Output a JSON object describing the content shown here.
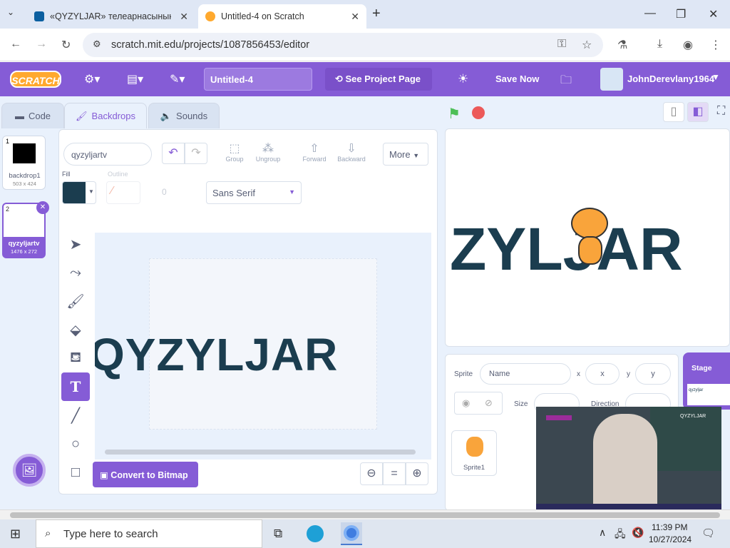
{
  "browser": {
    "tabs": [
      {
        "title": "«QYZYLJAR» телеарнасының р"
      },
      {
        "title": "Untitled-4 on Scratch"
      }
    ],
    "url": "scratch.mit.edu/projects/1087856453/editor"
  },
  "menubar": {
    "logo": "SCRATCH",
    "project_title": "Untitled-4",
    "see_project": "See Project Page",
    "save_now": "Save Now",
    "username": "JohnDerevlany1964"
  },
  "editor_tabs": [
    {
      "label": "Code"
    },
    {
      "label": "Backdrops"
    },
    {
      "label": "Sounds"
    }
  ],
  "costumes": [
    {
      "num": "1",
      "name": "backdrop1",
      "size": "503 x 424"
    },
    {
      "num": "2",
      "name": "qyzyljartv",
      "size": "1476 x 272"
    }
  ],
  "paint": {
    "costume_name": "qyzyljartv",
    "group": "Group",
    "ungroup": "Ungroup",
    "forward": "Forward",
    "backward": "Backward",
    "more": "More",
    "fill_label": "Fill",
    "outline_label": "Outline",
    "outline_value": "0",
    "font": "Sans Serif",
    "canvas_text": "QYZYLJAR",
    "convert": "Convert to Bitmap",
    "zoom_reset": "="
  },
  "stage": {
    "text": "ZYLJAR"
  },
  "sprite_info": {
    "sprite_label": "Sprite",
    "name_placeholder": "Name",
    "x_label": "x",
    "x_placeholder": "x",
    "y_label": "y",
    "y_placeholder": "y",
    "size_label": "Size",
    "direction_label": "Direction",
    "sprite1": "Sprite1",
    "stage_label": "Stage",
    "stage_thumb_text": "qyzyljar"
  },
  "video_overlay": {
    "badge": "QYZYLJAR"
  },
  "taskbar": {
    "search": "Type here to search",
    "time": "11:39 PM",
    "date": "10/27/2024"
  },
  "colors": {
    "scratch_purple": "#855cd6",
    "fill_color": "#1b3d4f",
    "text_dark": "#1b3d4f",
    "green_flag": "#4cbf56",
    "stop": "#ec5959"
  }
}
